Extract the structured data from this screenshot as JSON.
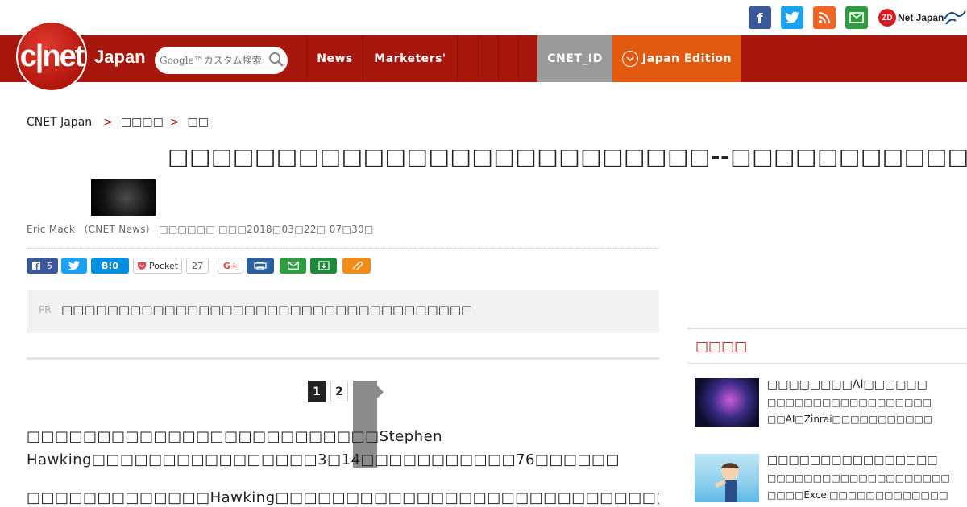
{
  "header": {
    "logo_text": "c|net",
    "logo_sub": "Japan",
    "search_placeholder": "Google™カスタム検索",
    "nav": [
      "News",
      "Marketers'",
      "CNET_ID",
      "Japan Edition"
    ]
  },
  "topbar": {
    "social": [
      "f",
      "t",
      "rss",
      "mail"
    ],
    "zdnet_mark": "ZD",
    "zdnet_text": "Net Japan"
  },
  "breadcrumb": {
    "home": "CNET Japan",
    "sep": ">",
    "level1": "□□□□",
    "level2": "□□"
  },
  "article": {
    "title": "□□□□□□□□□□□□□□□□□□□□□□□□□--□□□□□□□□□□□□□",
    "byline": "Eric Mack （CNET News） □□□□□□ □□□2018□03□22□ 07□30□",
    "pr_label": "PR",
    "pr_text": "□□□□□□□□□□□□□□□□□□□□□□□□□□□□□□□□□□□□",
    "para1": "□□□□□□□□□□□□□□□□□□□□□□□□□Stephen Hawking□□□□□□□□□□□□□□□□3□14□□□□□□□□□□□76□□□□□□",
    "para2": "□□□□□□□□□□□□□Hawking□□□□□□□□□□□□□□□□□□□□□□□□□□□□□□□□□□□□□□□□□□□□□"
  },
  "share": {
    "fb_count": "5",
    "hatena": "B!0",
    "pocket": "Pocket",
    "pocket_count": "27",
    "gplus": "G+"
  },
  "pagination": {
    "pages": [
      "1",
      "2"
    ],
    "current": "1"
  },
  "sidebar": {
    "heading": "□□□□",
    "items": [
      {
        "title": "□□□□□□□□AI□□□□□□",
        "desc1": "□□□□□□□□□□□□□□□□□□",
        "desc2": "□□AI□Zinrai□□□□□□□□□□□"
      },
      {
        "title": "□□□□□□□□□□□□□□□□",
        "desc1": "□□□□□□□□□□□□□□□□□□□□",
        "desc2": "□□□□Excel□□□□□□□□□□□□□"
      }
    ]
  }
}
